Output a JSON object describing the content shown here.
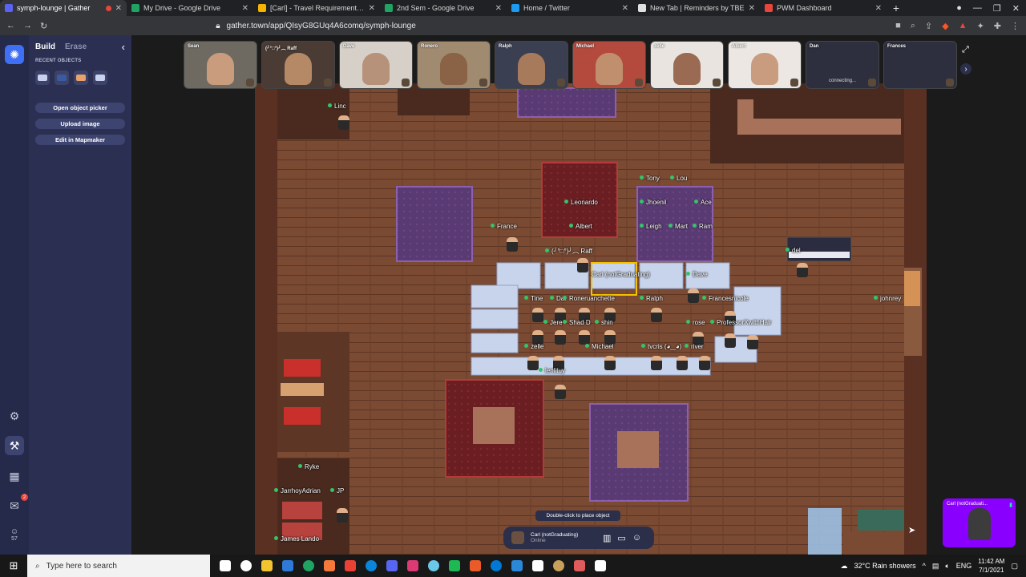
{
  "browser": {
    "tabs": [
      {
        "title": "symph-lounge | Gather",
        "active": true,
        "favicon_color": "#5b63f5"
      },
      {
        "title": "My Drive - Google Drive",
        "favicon_color": "#1fa463"
      },
      {
        "title": "[Carl] - Travel Requirements - Google",
        "favicon_color": "#f4b400"
      },
      {
        "title": "2nd Sem - Google Drive",
        "favicon_color": "#1fa463"
      },
      {
        "title": "Home / Twitter",
        "favicon_color": "#1d9bf0"
      },
      {
        "title": "New Tab | Reminders by TBE",
        "favicon_color": "#e0e0e0"
      },
      {
        "title": "PWM Dashboard",
        "favicon_color": "#e8453c"
      }
    ],
    "new_tab": "+",
    "url": "gather.town/app/QIsyG8GUq4A6comq/symph-lounge"
  },
  "build_panel": {
    "tab_build": "Build",
    "tab_erase": "Erase",
    "recent_label": "RECENT OBJECTS",
    "recent_colors": [
      "#c9d2ee",
      "#3b5aa0",
      "#e8a26a",
      "#c9d2ee"
    ],
    "buttons": [
      "Open object picker",
      "Upload image",
      "Edit in Mapmaker"
    ]
  },
  "rail": {
    "chat_badge": "2",
    "participants_count": "57"
  },
  "video_tiles": [
    {
      "name": "Sean",
      "bg": "#6e6a62",
      "face": "#c89c7c"
    },
    {
      "name": "(╯°□°)╯︵ Raff",
      "bg": "#4a3b35",
      "face": "#b58866"
    },
    {
      "name": "Dave",
      "bg": "#d7d0c8",
      "face": "#b7927a"
    },
    {
      "name": "Ronero",
      "bg": "#a08a70",
      "face": "#8a6245"
    },
    {
      "name": "Ralph",
      "bg": "#3b3f52",
      "face": "#a77a5c"
    },
    {
      "name": "Michael",
      "bg": "#b44a3e",
      "face": "#c0906e"
    },
    {
      "name": "zelle",
      "bg": "#e9e4e0",
      "face": "#9a6b52"
    },
    {
      "name": "Albert",
      "bg": "#ece7e2",
      "face": "#c99c80"
    },
    {
      "name": "Dan",
      "bg": "#2d2f3e",
      "face": "#2d2f3e",
      "status": "connecting..."
    },
    {
      "name": "Frances",
      "bg": "#2d2f3e",
      "face": "#2d2f3e"
    }
  ],
  "players": [
    {
      "name": "Linc",
      "dot": true
    },
    {
      "name": "Tony",
      "dot": true
    },
    {
      "name": "Lou",
      "dot": true
    },
    {
      "name": "Leonardo",
      "dot": true
    },
    {
      "name": "Jhoenil",
      "dot": true
    },
    {
      "name": "Ace",
      "dot": true
    },
    {
      "name": "France",
      "dot": true
    },
    {
      "name": "Albert",
      "dot": true
    },
    {
      "name": "Leigh",
      "dot": true
    },
    {
      "name": "Mart",
      "dot": true
    },
    {
      "name": "Ram",
      "dot": true
    },
    {
      "name": "(╯°□°)╯︵ Raff",
      "dot": true
    },
    {
      "name": "del",
      "dot": true
    },
    {
      "name": "Carl (notGraduating)",
      "dot": false
    },
    {
      "name": "Dave",
      "dot": true
    },
    {
      "name": "Tine",
      "dot": true
    },
    {
      "name": "Dar",
      "dot": true
    },
    {
      "name": "Roneruanchette",
      "dot": true
    },
    {
      "name": "Ralph",
      "dot": true
    },
    {
      "name": "Francesnicole",
      "dot": true
    },
    {
      "name": "johnrey",
      "dot": true
    },
    {
      "name": "Jere",
      "dot": true
    },
    {
      "name": "Shad D",
      "dot": true
    },
    {
      "name": "shin",
      "dot": true
    },
    {
      "name": "rose",
      "dot": true
    },
    {
      "name": "ProfessorXwithHair",
      "dot": true
    },
    {
      "name": "zelle",
      "dot": true
    },
    {
      "name": "Michael",
      "dot": true
    },
    {
      "name": "tvcris (◕‿◕)",
      "dot": true
    },
    {
      "name": "river",
      "dot": true
    },
    {
      "name": "lenlituy",
      "dot": true
    },
    {
      "name": "Ryke",
      "dot": true
    },
    {
      "name": "JarrhoyAdrian",
      "dot": true
    },
    {
      "name": "JP",
      "dot": true
    },
    {
      "name": "James Lando",
      "dot": true
    }
  ],
  "tooltip": "Double-click to place object",
  "self": {
    "name": "Carl (notGraduating)",
    "status": "Online"
  },
  "selfview_label": "Carl (notGraduati...",
  "taskbar": {
    "search_placeholder": "Type here to search",
    "app_colors": [
      "#ffffff",
      "#ffffff",
      "#f4c430",
      "#2f7ad8",
      "#1fa463",
      "#f5793a",
      "#e94235",
      "#0a85d9",
      "#5865f2",
      "#db3a74",
      "#6bc7e8",
      "#1db954",
      "#ea5b2a",
      "#0078d4",
      "#2b88d8",
      "#ffffff",
      "#c8a05a",
      "#e05b5b",
      "#ffffff"
    ],
    "weather": "32°C  Rain showers",
    "lang": "ENG",
    "time": "11:42 AM",
    "date": "7/1/2021"
  }
}
